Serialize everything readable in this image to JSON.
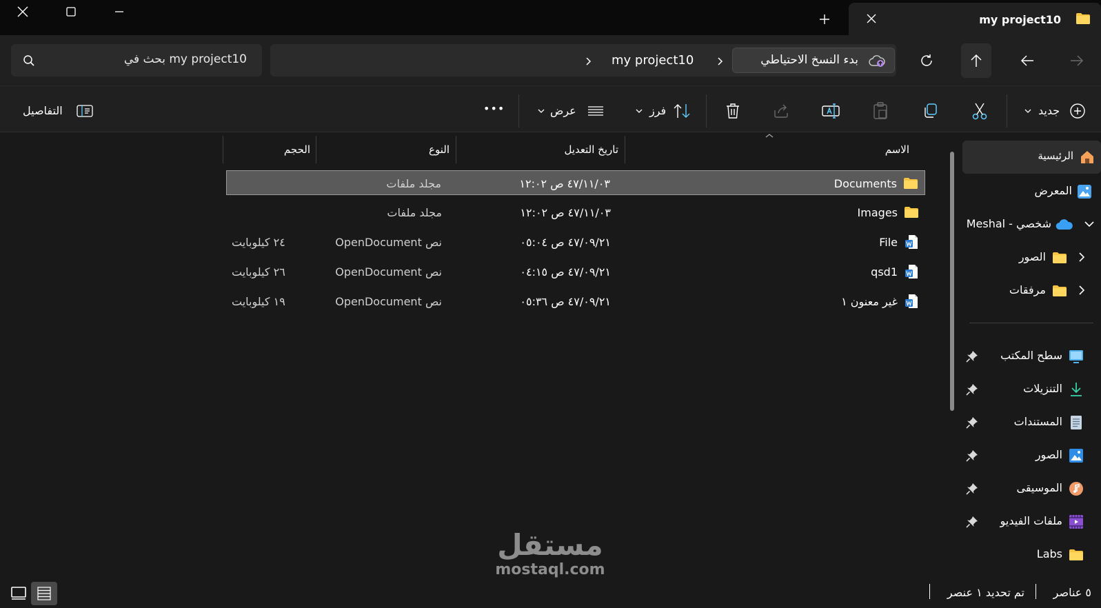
{
  "window": {
    "tab_title": "my project10",
    "new_tab": "+",
    "close_tab": "✕"
  },
  "nav": {
    "breadcrumb_backup": "بدء النسخ الاحتياطي",
    "breadcrumb_folder": "my project10",
    "search_placeholder": "بحث في my project10"
  },
  "toolbar": {
    "new_label": "جديد",
    "sort_label": "فرز",
    "view_label": "عرض",
    "more_label": "•••",
    "details_label": "التفاصيل"
  },
  "columns": {
    "name": "الاسم",
    "modified": "تاريخ التعديل",
    "type": "النوع",
    "size": "الحجم"
  },
  "files": [
    {
      "name": "Documents",
      "icon": "folder-icon",
      "modified": "٤٧/١١/٠٣ ص ١٢:٠٢",
      "type": "مجلد ملفات",
      "size": "",
      "selected": true
    },
    {
      "name": "Images",
      "icon": "folder-icon",
      "modified": "٤٧/١١/٠٣ ص ١٢:٠٢",
      "type": "مجلد ملفات",
      "size": "",
      "selected": false
    },
    {
      "name": "File",
      "icon": "word-document-icon",
      "modified": "٤٧/٠٩/٢١ ص ٠٥:٠٤",
      "type": "OpenDocument نص",
      "size": "٢٤ كيلوبايت",
      "selected": false
    },
    {
      "name": "qsd1",
      "icon": "word-document-icon",
      "modified": "٤٧/٠٩/٢١ ص ٠٤:١٥",
      "type": "OpenDocument نص",
      "size": "٢٦ كيلوبايت",
      "selected": false
    },
    {
      "name": "غير معنون ١",
      "icon": "word-document-icon",
      "modified": "٤٧/٠٩/٢١ ص ٠٥:٣٦",
      "type": "OpenDocument نص",
      "size": "١٩ كيلوبايت",
      "selected": false
    }
  ],
  "sidebar": {
    "home": "الرئيسية",
    "gallery": "المعرض",
    "onedrive": "Meshal - شخصي",
    "onedrive_children": [
      "الصور",
      "مرفقات"
    ],
    "quick_access": [
      {
        "label": "سطح المكتب",
        "icon": "desktop-icon"
      },
      {
        "label": "التنزيلات",
        "icon": "download-icon"
      },
      {
        "label": "المستندات",
        "icon": "documents-icon"
      },
      {
        "label": "الصور",
        "icon": "pictures-icon"
      },
      {
        "label": "الموسيقى",
        "icon": "music-icon"
      },
      {
        "label": "ملفات الفيديو",
        "icon": "videos-icon"
      },
      {
        "label": "Labs",
        "icon": "folder-icon"
      }
    ]
  },
  "status": {
    "item_count": "٥ عناصر",
    "selection": "تم تحديد ١ عنصر"
  },
  "watermark": {
    "arabic": "مستقل",
    "latin": "mostaql.com"
  },
  "colors": {
    "accent": "#60cdff",
    "folder": "#f5c542",
    "background": "#191919",
    "selected_row": "#5a5a5a"
  }
}
